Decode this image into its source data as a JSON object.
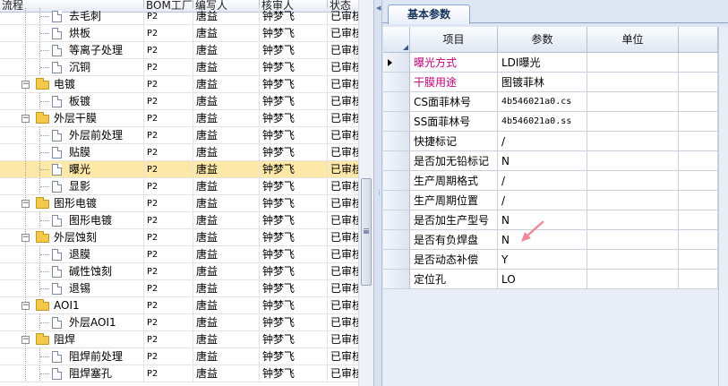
{
  "tree": {
    "columns": [
      "流程",
      "BOM工厂",
      "编写人",
      "核审人",
      "状态"
    ],
    "rows": [
      {
        "level": 2,
        "type": "doc",
        "label": "去毛刺",
        "bom": "P2",
        "author": "唐益",
        "reviewer": "钟梦飞",
        "status": "已审核"
      },
      {
        "level": 2,
        "type": "doc",
        "label": "烘板",
        "bom": "P2",
        "author": "唐益",
        "reviewer": "钟梦飞",
        "status": "已审核"
      },
      {
        "level": 2,
        "type": "doc",
        "label": "等离子处理",
        "bom": "P2",
        "author": "唐益",
        "reviewer": "钟梦飞",
        "status": "已审核"
      },
      {
        "level": 2,
        "type": "doc",
        "label": "沉铜",
        "bom": "P2",
        "author": "唐益",
        "reviewer": "钟梦飞",
        "status": "已审核"
      },
      {
        "level": 1,
        "type": "folder",
        "label": "电镀",
        "bom": "P2",
        "author": "唐益",
        "reviewer": "钟梦飞",
        "status": "已审核"
      },
      {
        "level": 2,
        "type": "doc",
        "label": "板镀",
        "bom": "P2",
        "author": "唐益",
        "reviewer": "钟梦飞",
        "status": "已审核"
      },
      {
        "level": 1,
        "type": "folder",
        "label": "外层干膜",
        "bom": "P2",
        "author": "唐益",
        "reviewer": "钟梦飞",
        "status": "已审核"
      },
      {
        "level": 2,
        "type": "doc",
        "label": "外层前处理",
        "bom": "P2",
        "author": "唐益",
        "reviewer": "钟梦飞",
        "status": "已审核"
      },
      {
        "level": 2,
        "type": "doc",
        "label": "贴膜",
        "bom": "P2",
        "author": "唐益",
        "reviewer": "钟梦飞",
        "status": "已审核"
      },
      {
        "level": 2,
        "type": "doc",
        "label": "曝光",
        "bom": "P2",
        "author": "唐益",
        "reviewer": "钟梦飞",
        "status": "已审核",
        "selected": true
      },
      {
        "level": 2,
        "type": "doc",
        "label": "显影",
        "bom": "P2",
        "author": "唐益",
        "reviewer": "钟梦飞",
        "status": "已审核"
      },
      {
        "level": 1,
        "type": "folder",
        "label": "图形电镀",
        "bom": "P2",
        "author": "唐益",
        "reviewer": "钟梦飞",
        "status": "已审核"
      },
      {
        "level": 2,
        "type": "doc",
        "label": "图形电镀",
        "bom": "P2",
        "author": "唐益",
        "reviewer": "钟梦飞",
        "status": "已审核"
      },
      {
        "level": 1,
        "type": "folder",
        "label": "外层蚀刻",
        "bom": "P2",
        "author": "唐益",
        "reviewer": "钟梦飞",
        "status": "已审核"
      },
      {
        "level": 2,
        "type": "doc",
        "label": "退膜",
        "bom": "P2",
        "author": "唐益",
        "reviewer": "钟梦飞",
        "status": "已审核"
      },
      {
        "level": 2,
        "type": "doc",
        "label": "碱性蚀刻",
        "bom": "P2",
        "author": "唐益",
        "reviewer": "钟梦飞",
        "status": "已审核"
      },
      {
        "level": 2,
        "type": "doc",
        "label": "退锡",
        "bom": "P2",
        "author": "唐益",
        "reviewer": "钟梦飞",
        "status": "已审核"
      },
      {
        "level": 1,
        "type": "folder",
        "label": "AOI1",
        "bom": "P2",
        "author": "唐益",
        "reviewer": "钟梦飞",
        "status": "已审核"
      },
      {
        "level": 2,
        "type": "doc",
        "label": "外层AOI1",
        "bom": "P2",
        "author": "唐益",
        "reviewer": "钟梦飞",
        "status": "已审核"
      },
      {
        "level": 1,
        "type": "folder",
        "label": "阻焊",
        "bom": "P2",
        "author": "唐益",
        "reviewer": "钟梦飞",
        "status": "已审核"
      },
      {
        "level": 2,
        "type": "doc",
        "label": "阻焊前处理",
        "bom": "P2",
        "author": "唐益",
        "reviewer": "钟梦飞",
        "status": "已审核"
      },
      {
        "level": 2,
        "type": "doc",
        "label": "阻焊塞孔",
        "bom": "P2",
        "author": "唐益",
        "reviewer": "钟梦飞",
        "status": "已审核"
      }
    ]
  },
  "panel": {
    "tab_label": "基本参数",
    "columns": [
      "项目",
      "参数",
      "单位"
    ],
    "rows": [
      {
        "item": "曝光方式",
        "value": "LDI曝光",
        "unit": "",
        "pink": true,
        "current": true
      },
      {
        "item": "干膜用途",
        "value": "图镀菲林",
        "unit": "",
        "pink": true
      },
      {
        "item": "CS面菲林号",
        "value": "4b546021a0.cs",
        "unit": ""
      },
      {
        "item": "SS面菲林号",
        "value": "4b546021a0.ss",
        "unit": ""
      },
      {
        "item": "快捷标记",
        "value": "/",
        "unit": ""
      },
      {
        "item": "是否加无铅标记",
        "value": "N",
        "unit": ""
      },
      {
        "item": "生产周期格式",
        "value": "/",
        "unit": ""
      },
      {
        "item": "生产周期位置",
        "value": "/",
        "unit": ""
      },
      {
        "item": "是否加生产型号",
        "value": "N",
        "unit": ""
      },
      {
        "item": "是否有负焊盘",
        "value": "N",
        "unit": ""
      },
      {
        "item": "是否动态补偿",
        "value": "Y",
        "unit": ""
      },
      {
        "item": "定位孔",
        "value": "LO",
        "unit": ""
      }
    ]
  },
  "colors": {
    "selected_row": "#fde8a8",
    "pink_text": "#c0007a",
    "pointer_arrow": "#f08a9a"
  }
}
